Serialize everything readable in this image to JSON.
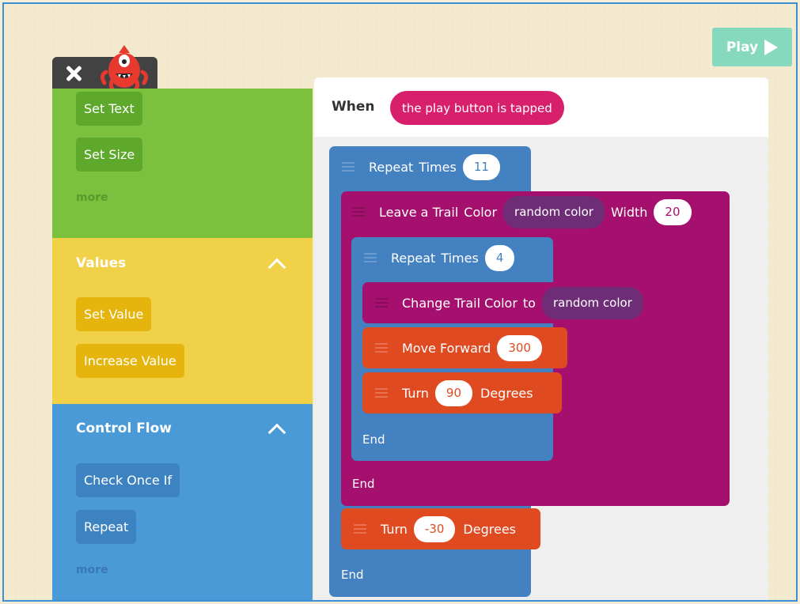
{
  "toolbar": {
    "play_label": "Play"
  },
  "palette": {
    "green": {
      "blocks": [
        "Set Text",
        "Set Size"
      ],
      "more": "more"
    },
    "values": {
      "title": "Values",
      "blocks": [
        "Set Value",
        "Increase Value"
      ]
    },
    "control": {
      "title": "Control Flow",
      "blocks": [
        "Check Once If",
        "Repeat"
      ],
      "more": "more"
    }
  },
  "script": {
    "when_label": "When",
    "event": "the play button is tapped",
    "repeat1": {
      "label": "Repeat",
      "word": "Times",
      "value": "11"
    },
    "trail": {
      "label": "Leave a Trail",
      "color_word": "Color",
      "color_value": "random color",
      "width_word": "Width",
      "width_value": "20"
    },
    "repeat2": {
      "label": "Repeat",
      "word": "Times",
      "value": "4"
    },
    "change": {
      "label": "Change Trail Color",
      "to_word": "to",
      "value": "random color"
    },
    "move": {
      "label": "Move Forward",
      "value": "300"
    },
    "turn1": {
      "label": "Turn",
      "value": "90",
      "unit": "Degrees"
    },
    "end_inner": "End",
    "end_trail": "End",
    "turn2": {
      "label": "Turn",
      "value": "-30",
      "unit": "Degrees"
    },
    "end_outer": "End"
  },
  "colors": {
    "green": "#7bc13e",
    "yellow": "#f1d148",
    "blue": "#4a9ad8",
    "control": "#4381c1",
    "magenta": "#a5106e",
    "orange": "#e04a21",
    "event": "#d71f6b"
  }
}
